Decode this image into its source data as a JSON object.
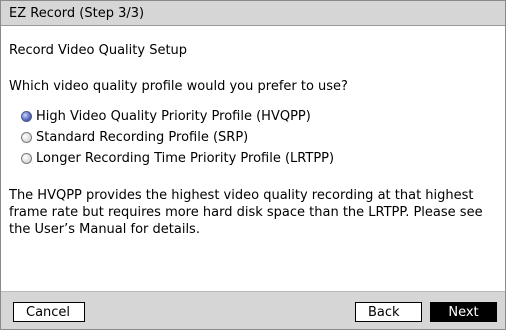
{
  "window": {
    "title": "EZ Record (Step 3/3)"
  },
  "content": {
    "subtitle": "Record Video Quality Setup",
    "question": "Which video quality profile would you prefer to use?",
    "options": [
      {
        "label": "High Video Quality Priority Profile (HVQPP)",
        "selected": true
      },
      {
        "label": "Standard Recording Profile (SRP)",
        "selected": false
      },
      {
        "label": "Longer Recording Time Priority Profile (LRTPP)",
        "selected": false
      }
    ],
    "description": "The HVQPP provides the highest video quality recording at that highest frame rate but requires more hard disk space than the LRTPP. Please see the User’s Manual for details."
  },
  "buttons": {
    "cancel": "Cancel",
    "back": "Back",
    "next": "Next"
  },
  "colors": {
    "titlebar": "#d6d6d6",
    "footer": "#d6d6d6",
    "next_button": "#000000",
    "radio_selected": "#5a6fbf"
  }
}
